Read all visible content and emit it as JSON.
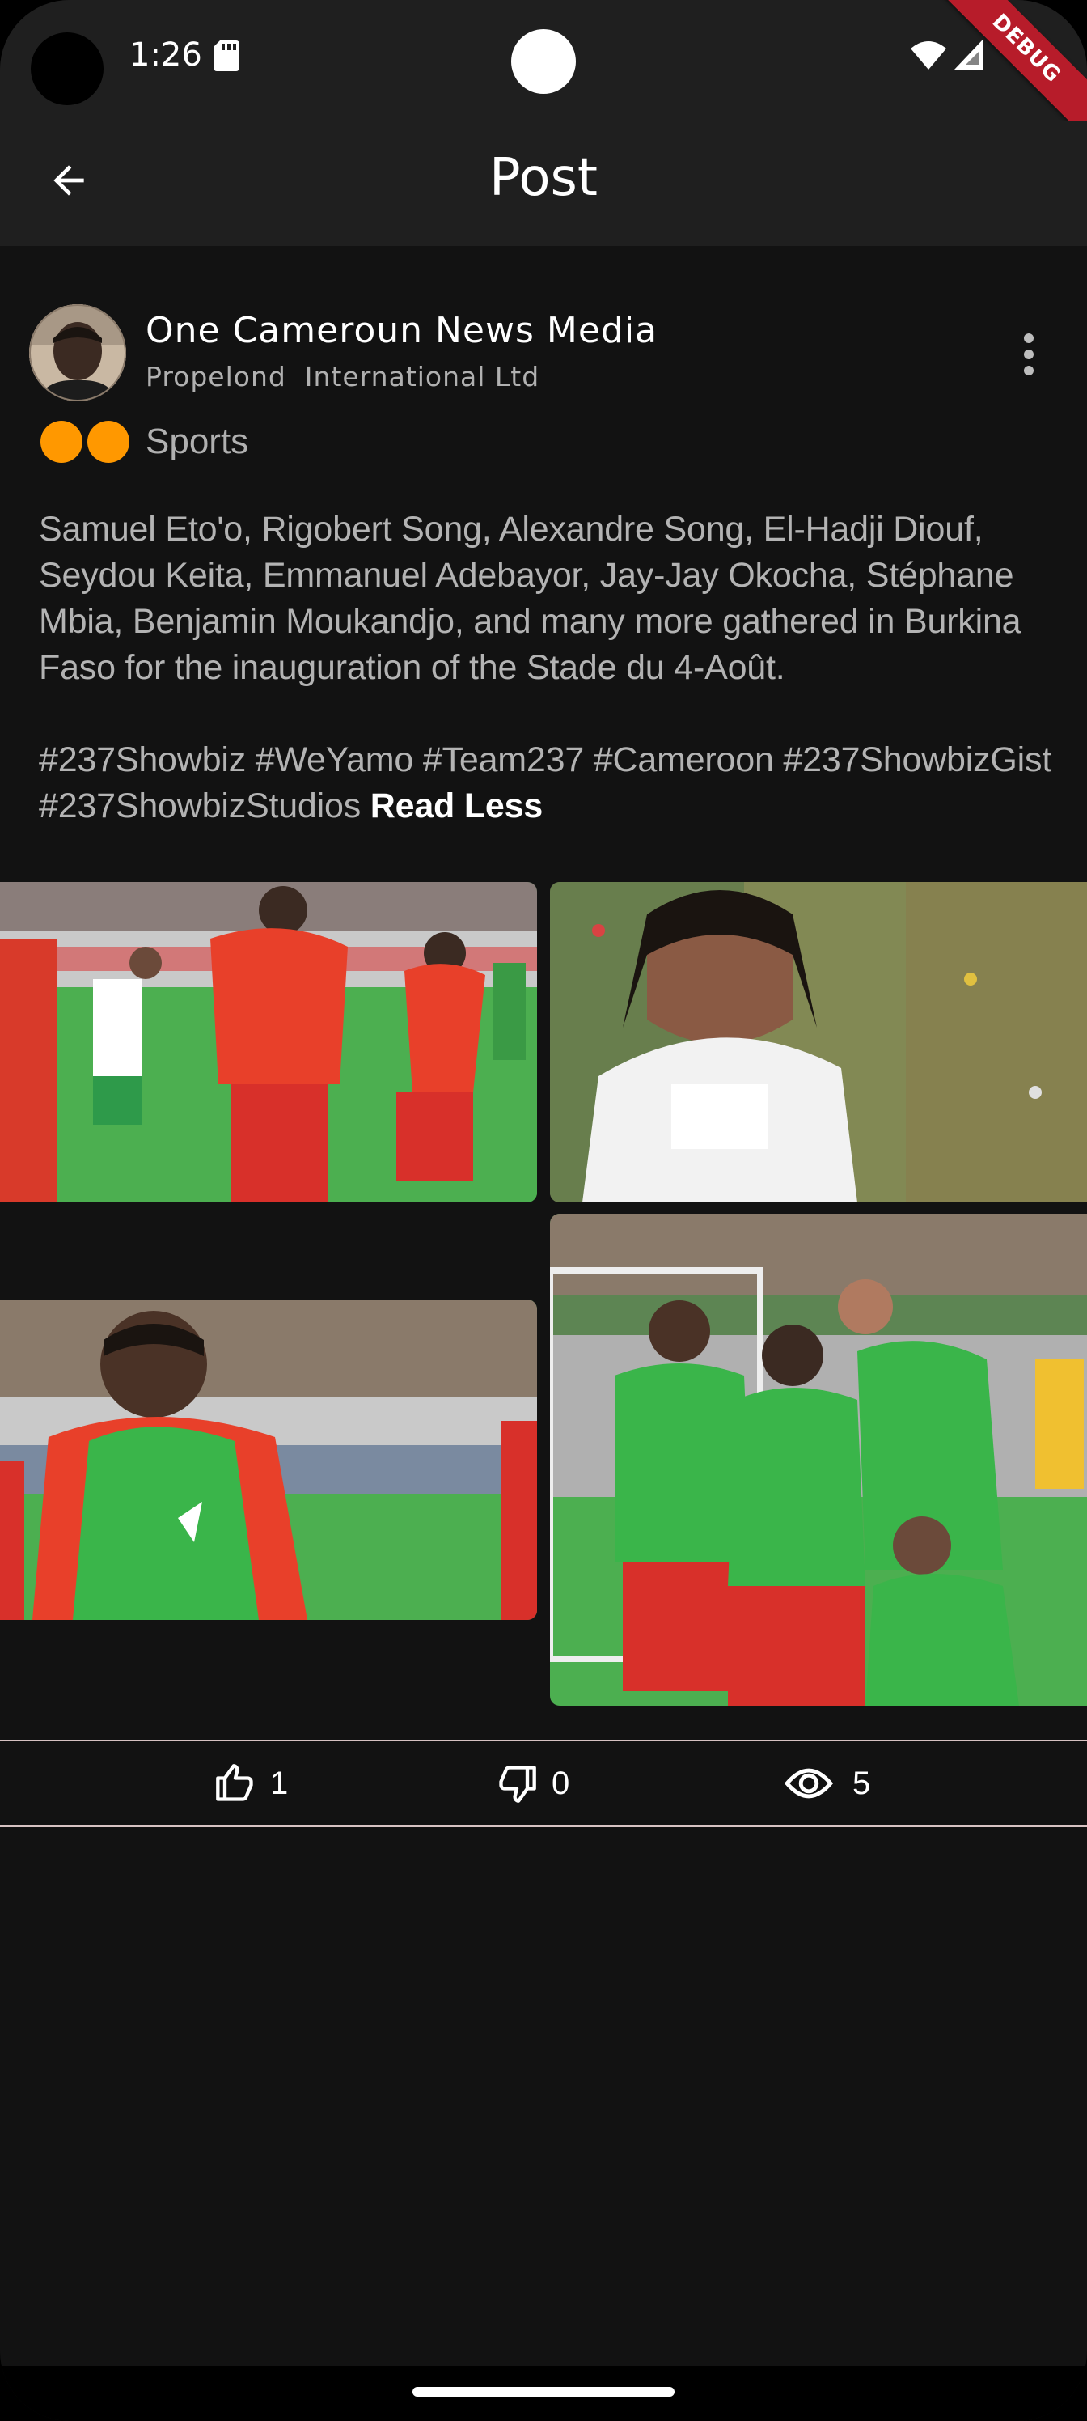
{
  "status_bar": {
    "time": "1:26",
    "debug_label": "DEBUG",
    "icons": [
      "sd-card-icon",
      "wifi-icon",
      "cell-signal-icon"
    ]
  },
  "app_bar": {
    "title": "Post",
    "back_icon": "arrow-back-icon"
  },
  "post": {
    "author": {
      "name": "One Cameroun News Media",
      "organization": "Propelond  International Ltd"
    },
    "category": {
      "label": "Sports",
      "dot_color": "#ff9800"
    },
    "text": "Samuel Eto'o, Rigobert Song, Alexandre Song, El-Hadji Diouf, Seydou Keita, Emmanuel Adebayor, Jay-Jay Okocha, Stéphane Mbia, Benjamin Moukandjo, and many more gathered in Burkina Faso for the inauguration of the Stade du 4-Août.",
    "hashtags": "#237Showbiz #WeYamo #Team237 #Cameroon #237ShowbizGist #237ShowbizStudios",
    "read_less_label": "Read Less",
    "images_count": 4
  },
  "reactions": {
    "likes": "1",
    "dislikes": "0",
    "views": "5"
  },
  "colors": {
    "background": "#121212",
    "app_bar": "#1f1f1f",
    "debug_ribbon": "#b71c2a",
    "divider": "#d6c2c2"
  }
}
